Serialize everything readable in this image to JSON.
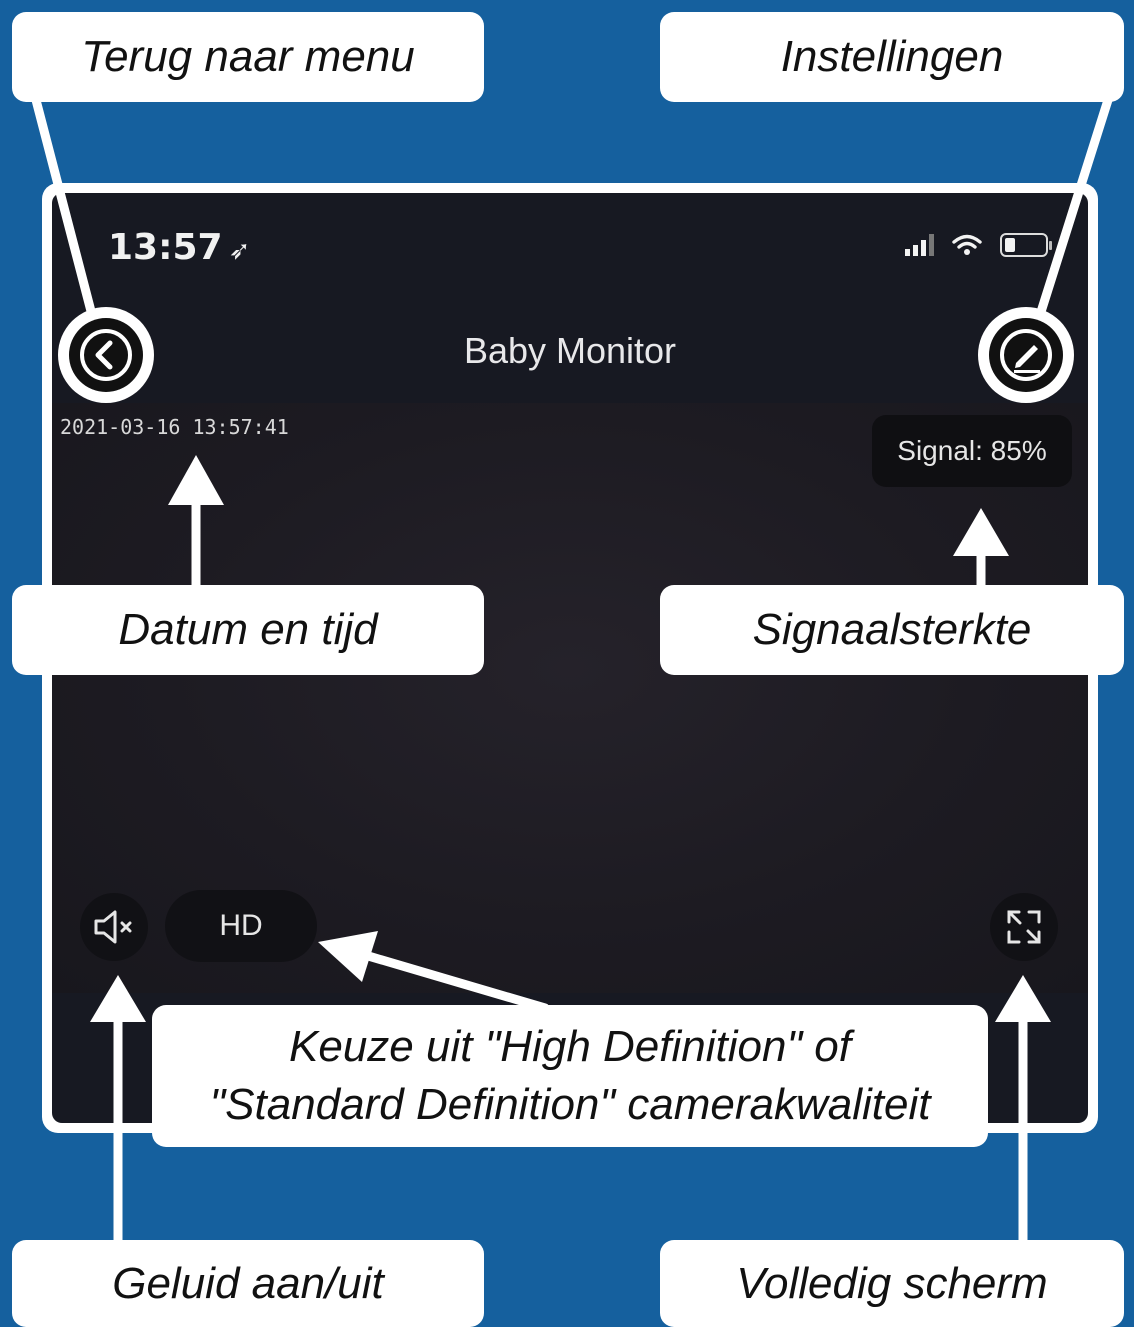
{
  "status_bar": {
    "time": "13:57",
    "location_icon": "location-arrow-icon",
    "signal_icon": "cellular-bars-icon",
    "wifi_icon": "wifi-icon",
    "battery_icon": "battery-low-icon"
  },
  "header": {
    "title": "Baby Monitor",
    "back_icon": "chevron-left-icon",
    "settings_icon": "pencil-edit-icon"
  },
  "video": {
    "datetime": "2021-03-16 13:57:41",
    "signal": "Signal: 85%"
  },
  "controls": {
    "mute_icon": "speaker-muted-icon",
    "quality_label": "HD",
    "fullscreen_icon": "expand-fullscreen-icon"
  },
  "annotations": {
    "back": "Terug naar menu",
    "settings": "Instellingen",
    "datetime": "Datum en tijd",
    "signal": "Signaalsterkte",
    "quality_line1": "Keuze uit \"High Definition\" of",
    "quality_line2": "\"Standard Definition\" camerakwaliteit",
    "sound": "Geluid aan/uit",
    "fullscreen": "Volledig scherm"
  },
  "colors": {
    "background": "#15609e",
    "screen": "#171922",
    "label": "#ffffff"
  }
}
